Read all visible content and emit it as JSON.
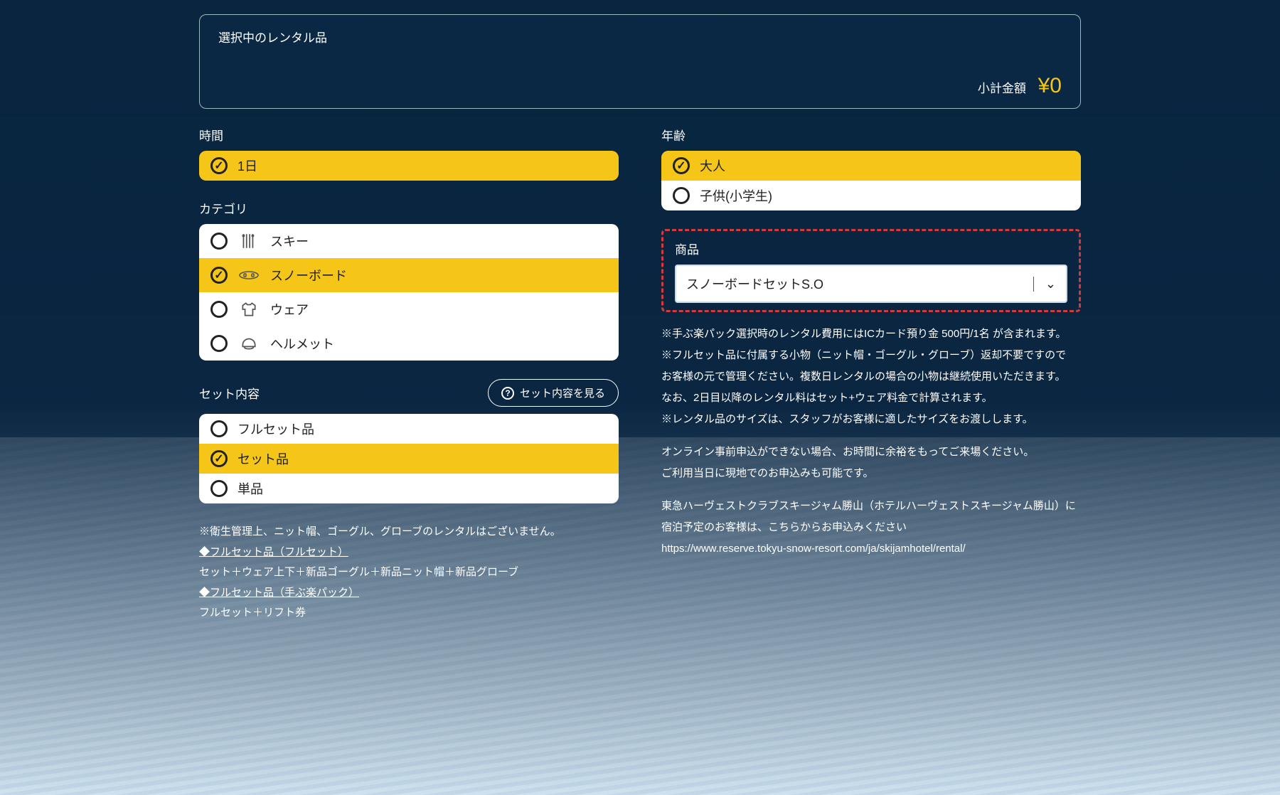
{
  "cart": {
    "title": "選択中のレンタル品",
    "subtotal_label": "小計金額",
    "subtotal_amount": "¥0"
  },
  "time": {
    "label": "時間",
    "options": [
      {
        "label": "1日",
        "selected": true
      }
    ]
  },
  "category": {
    "label": "カテゴリ",
    "options": [
      {
        "label": "スキー",
        "icon": "ski",
        "selected": false
      },
      {
        "label": "スノーボード",
        "icon": "snowboard",
        "selected": true
      },
      {
        "label": "ウェア",
        "icon": "wear",
        "selected": false
      },
      {
        "label": "ヘルメット",
        "icon": "helmet",
        "selected": false
      }
    ]
  },
  "set": {
    "label": "セット内容",
    "view_button": "セット内容を見る",
    "options": [
      {
        "label": "フルセット品",
        "selected": false
      },
      {
        "label": "セット品",
        "selected": true
      },
      {
        "label": "単品",
        "selected": false
      }
    ]
  },
  "left_notes": {
    "line1": "※衛生管理上、ニット帽、ゴーグル、グローブのレンタルはございません。",
    "line2": "◆フルセット品（フルセット）",
    "line3": "セット＋ウェア上下＋新品ゴーグル＋新品ニット帽＋新品グローブ",
    "line4": "◆フルセット品（手ぶ楽パック）",
    "line5": "フルセット＋リフト券"
  },
  "age": {
    "label": "年齢",
    "options": [
      {
        "label": "大人",
        "selected": true
      },
      {
        "label": "子供(小学生)",
        "selected": false
      }
    ]
  },
  "product": {
    "label": "商品",
    "selected": "スノーボードセットS.O"
  },
  "right_info": {
    "p1": "※手ぶ楽パック選択時のレンタル費用にはICカード預り金 500円/1名 が含まれます。",
    "p2": "※フルセット品に付属する小物（ニット帽・ゴーグル・グローブ）返却不要ですので",
    "p3": "お客様の元で管理ください。複数日レンタルの場合の小物は継続使用いただきます。",
    "p4": "なお、2日目以降のレンタル料はセット+ウェア料金で計算されます。",
    "p5": "※レンタル品のサイズは、スタッフがお客様に適したサイズをお渡しします。",
    "p6": "オンライン事前申込ができない場合、お時間に余裕をもってご来場ください。",
    "p7": "ご利用当日に現地でのお申込みも可能です。",
    "p8": "東急ハーヴェストクラブスキージャム勝山（ホテルハーヴェストスキージャム勝山）に宿泊予定のお客様は、こちらからお申込みください",
    "p9": "https://www.reserve.tokyu-snow-resort.com/ja/skijamhotel/rental/"
  }
}
